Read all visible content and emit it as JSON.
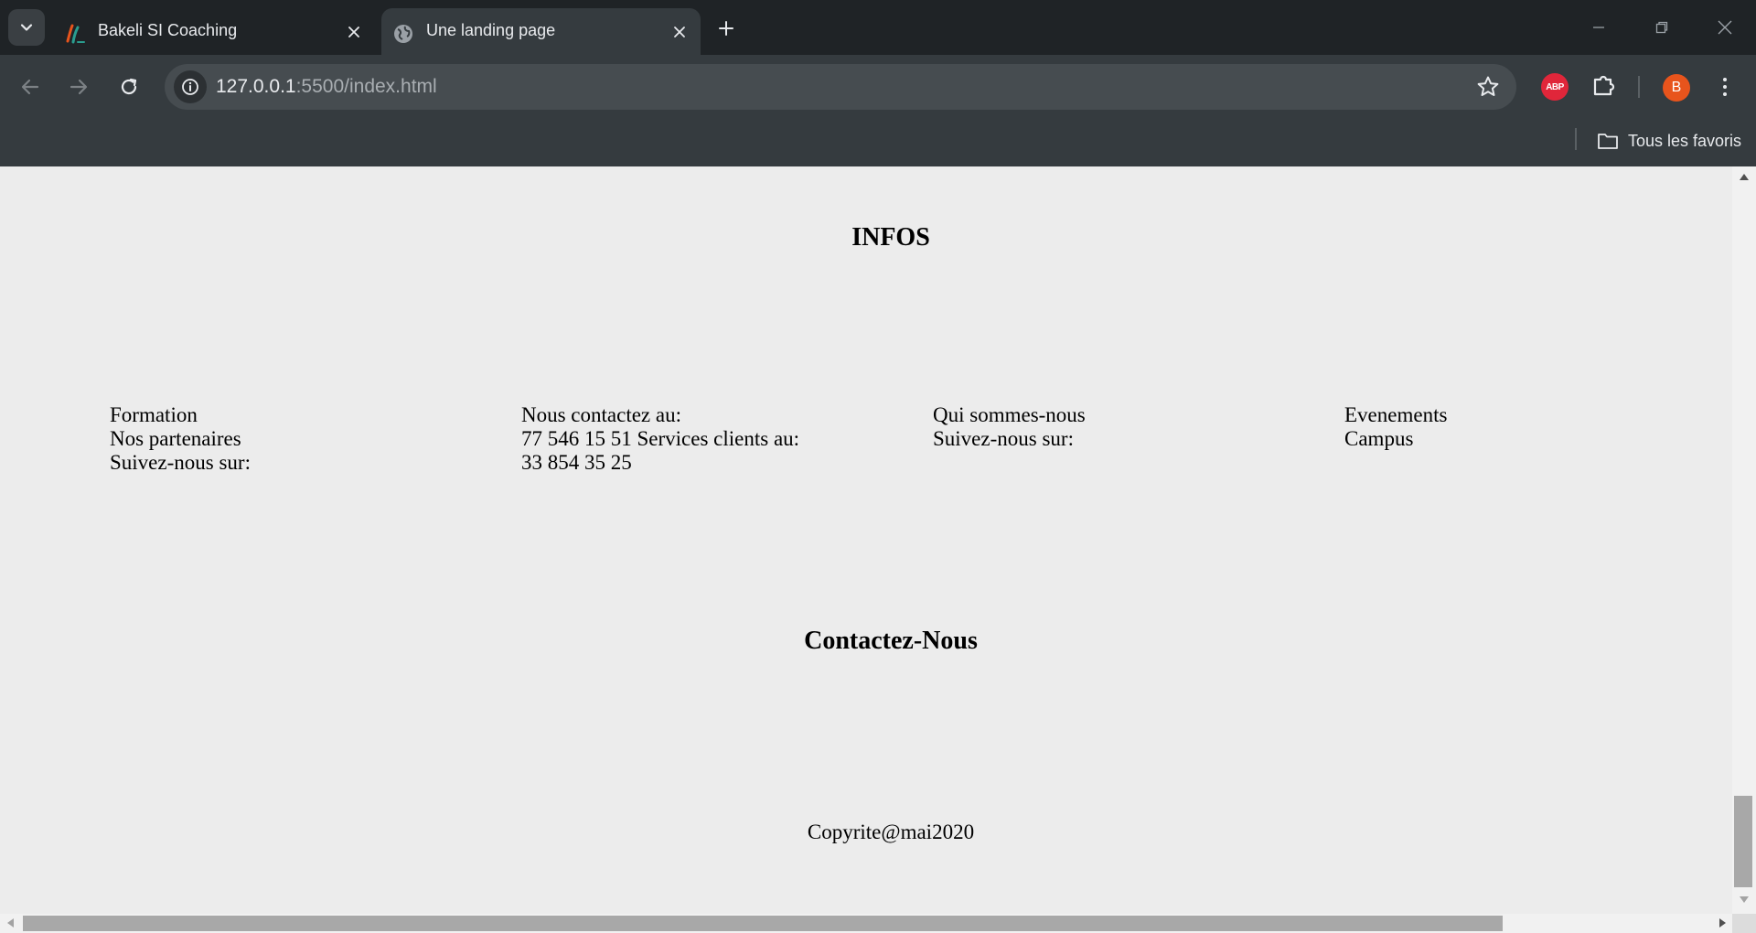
{
  "tabs": [
    {
      "title": "Bakeli SI Coaching",
      "active": false
    },
    {
      "title": "Une landing page",
      "active": true
    }
  ],
  "toolbar": {
    "url_host": "127.0.0.1",
    "url_path": ":5500/index.html",
    "abp_label": "ABP",
    "profile_initial": "B"
  },
  "bookmarks": {
    "all_bookmarks_label": "Tous les favoris"
  },
  "page": {
    "infos_title": "INFOS",
    "columns": [
      {
        "lines": [
          "Formation",
          "Nos partenaires",
          "Suivez-nous sur:"
        ]
      },
      {
        "lines": [
          "Nous contactez au:",
          "77 546 15 51 Services clients au:",
          "33 854 35 25"
        ]
      },
      {
        "lines": [
          "Qui sommes-nous",
          "Suivez-nous sur:"
        ]
      },
      {
        "lines": [
          "Evenements",
          "Campus"
        ]
      }
    ],
    "contact_title": "Contactez-Nous",
    "copyright": "Copyrite@mai2020"
  },
  "colors": {
    "tabstrip_bg": "#1f2326",
    "toolbar_bg": "#353b3f",
    "omnibox_bg": "#464c50",
    "page_bg": "#ececec",
    "abp_red": "#e0263a",
    "avatar_orange": "#e8541c"
  },
  "icons": {
    "tab_search": "chevron-down-icon",
    "inactive_tab_favicon": "bakeli-logo-icon",
    "active_tab_favicon": "globe-icon",
    "site_info": "info-icon",
    "bookmark_star": "star-icon",
    "extensions": "puzzle-icon",
    "bookmark_folder": "folder-icon"
  }
}
